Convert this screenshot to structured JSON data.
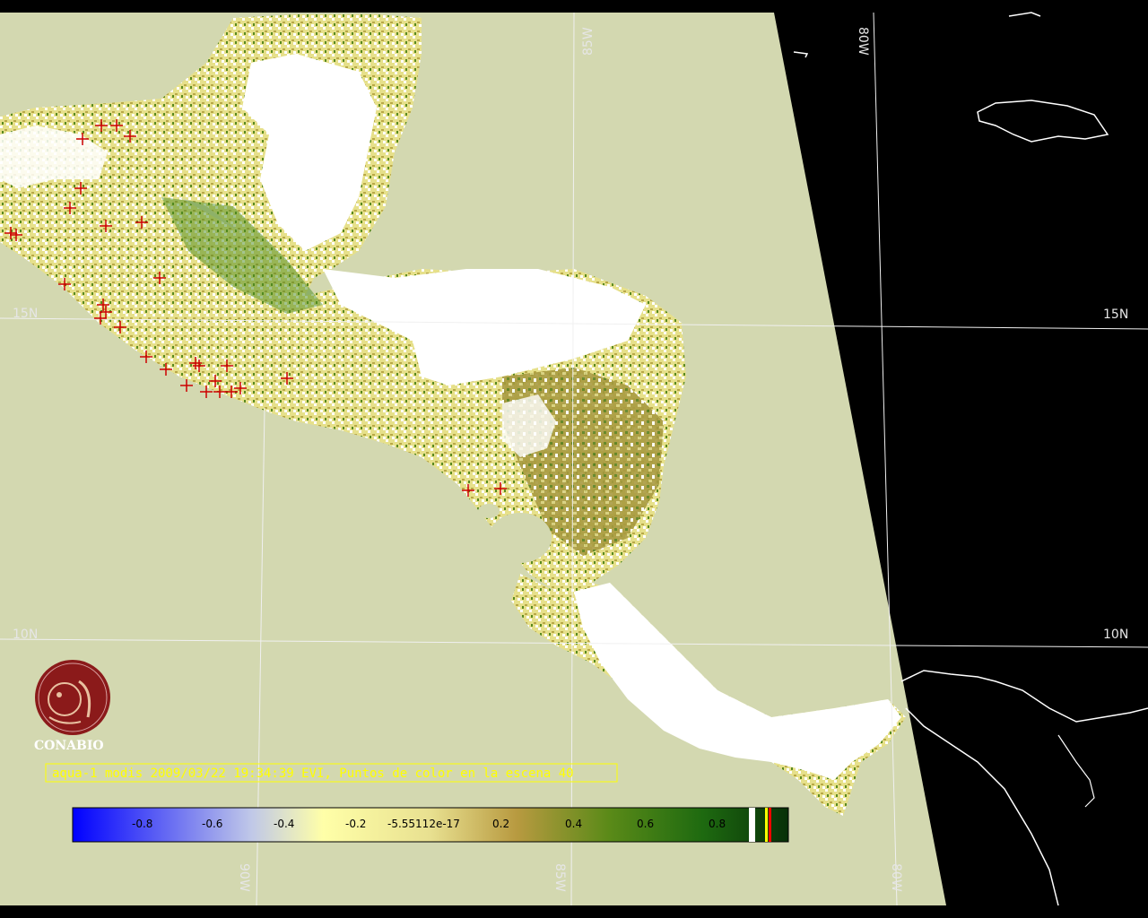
{
  "colors": {
    "ocean": "#d3d8b0",
    "outside": "#000000",
    "cloud": "#ffffff",
    "grid": "#f0f0f0",
    "fire_marker": "#cc0000",
    "caption": "#ffff00",
    "logo": "#8b1a1a"
  },
  "grid_labels": {
    "lon_85w_top": "85W",
    "lon_80w_top": "80W",
    "lat_15n_left": "15N",
    "lat_15n_right": "15N",
    "lat_10n_left": "10N",
    "lat_10n_right": "10N",
    "lon_90w_bottom": "90W",
    "lon_85w_bottom": "85W",
    "lon_80w_bottom": "80W"
  },
  "logo": {
    "name": "CONABIO",
    "icon": "conabio-seal-icon"
  },
  "caption": "aqua-1 modis 2009/03/22 19:34:39 EVI, Puntos de color en la escena 40",
  "legend": {
    "ticks": [
      "-0.8",
      "-0.6",
      "-0.4",
      "-0.2",
      "-5.55112e-17",
      "0.2",
      "0.4",
      "0.6",
      "0.8"
    ],
    "colors": [
      "#0000ff",
      "#ffffa0",
      "#b8a040",
      "#2a7a10",
      "#0e3a0e"
    ]
  }
}
